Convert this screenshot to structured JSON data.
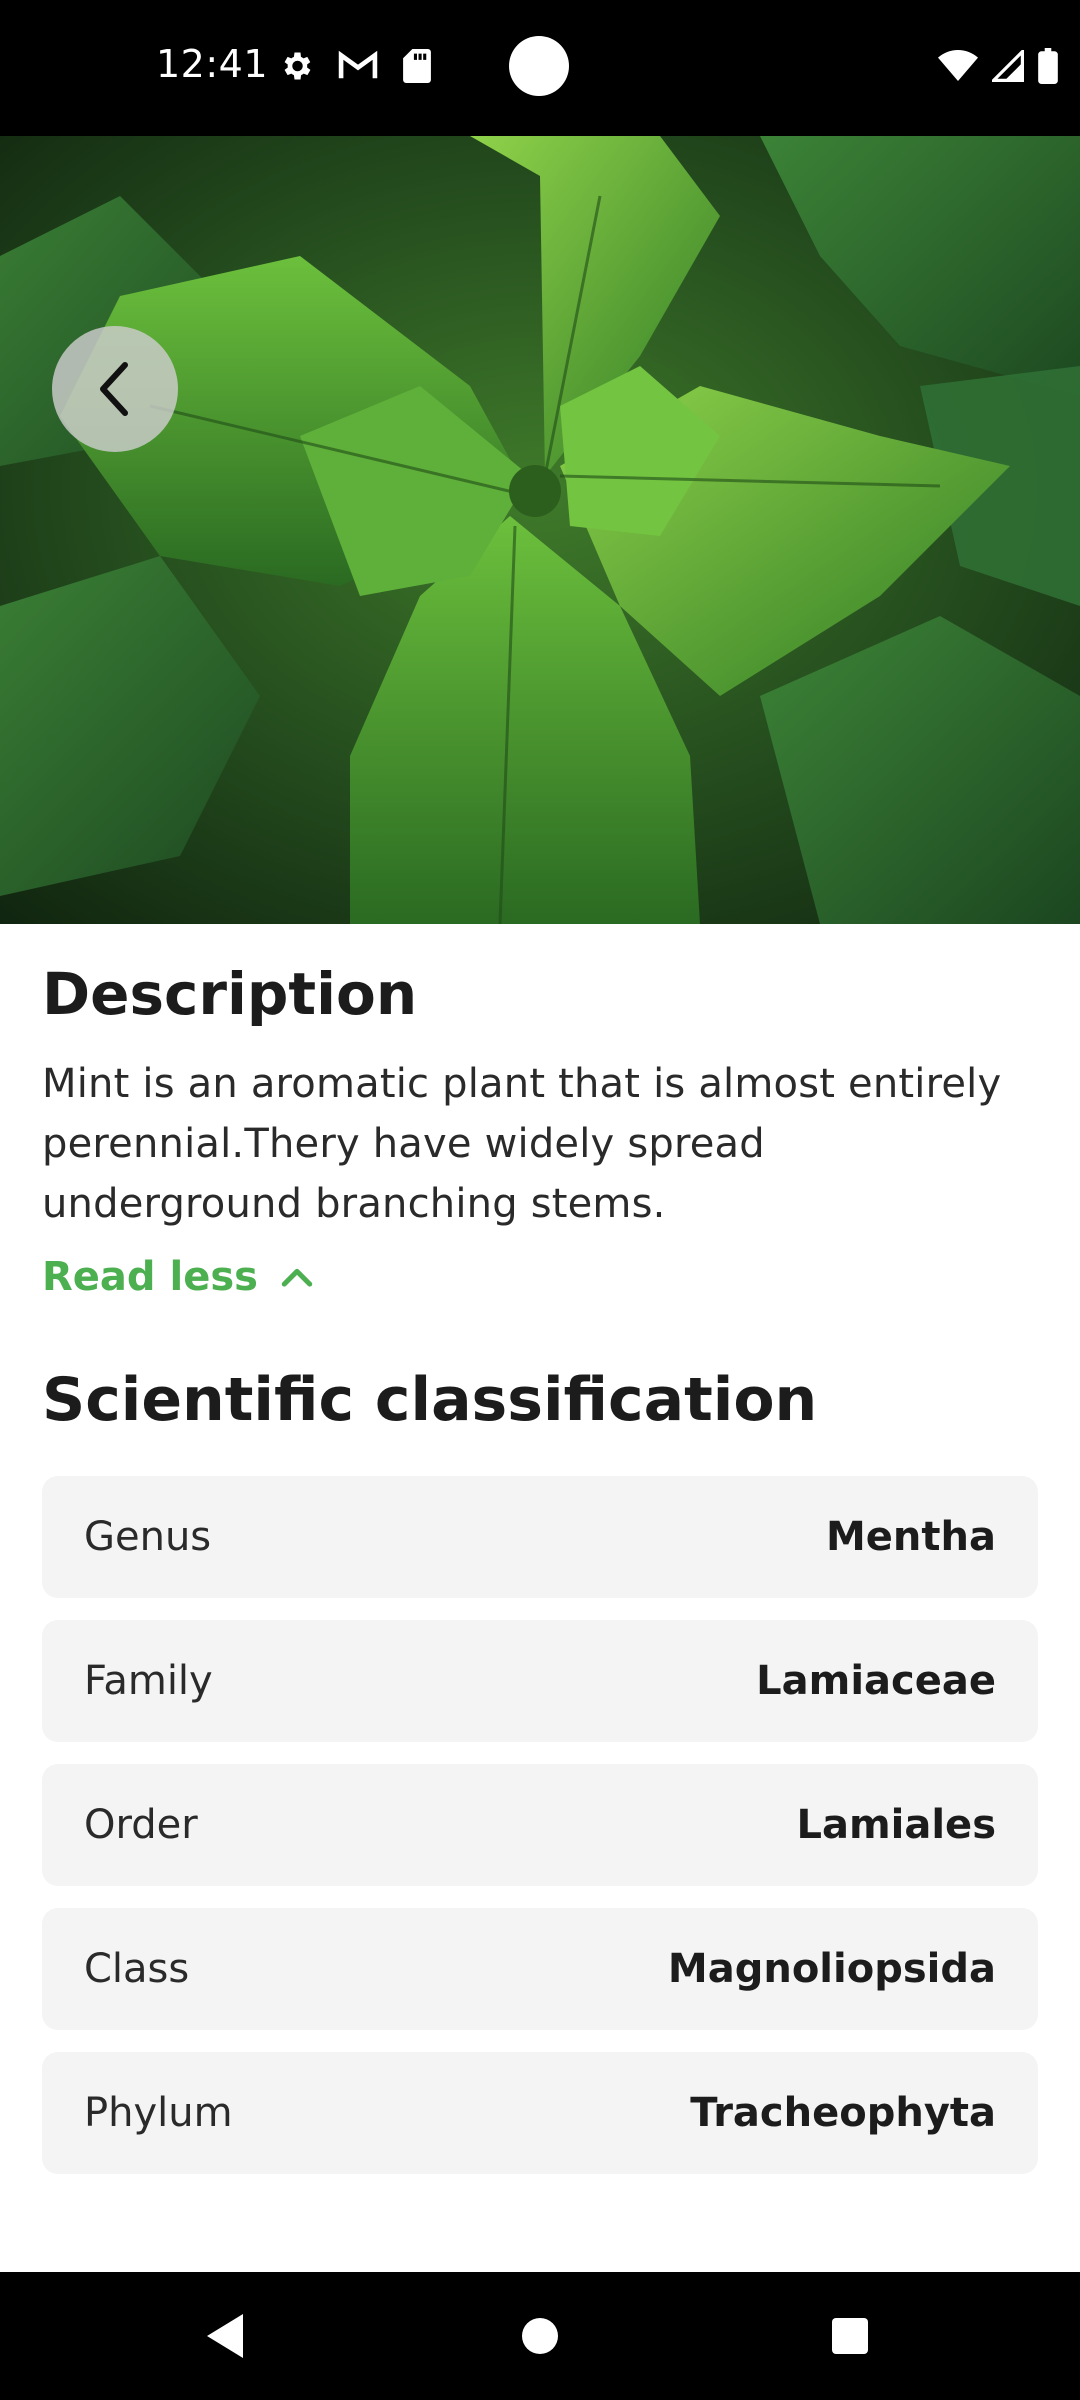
{
  "status_bar": {
    "time": "12:41",
    "icons_left": [
      "settings-icon",
      "gmail-icon",
      "sd-card-icon"
    ],
    "icons_right": [
      "wifi-icon",
      "signal-icon",
      "battery-icon"
    ]
  },
  "hero": {
    "image": "stinging-nettle-plant-photo",
    "back_icon": "chevron-left-icon"
  },
  "description": {
    "title": "Description",
    "text": "Mint is an aromatic plant that is almost entirely perennial.Thery have widely spread underground branching stems.",
    "toggle_label": "Read less",
    "toggle_icon": "chevron-up-icon"
  },
  "classification": {
    "title": "Scientific classification",
    "rows": [
      {
        "label": "Genus",
        "value": "Mentha"
      },
      {
        "label": "Family",
        "value": "Lamiaceae"
      },
      {
        "label": "Order",
        "value": "Lamiales"
      },
      {
        "label": "Class",
        "value": "Magnoliopsida"
      },
      {
        "label": "Phylum",
        "value": "Tracheophyta"
      }
    ]
  },
  "nav_bar": {
    "icons": [
      "back-triangle-icon",
      "home-circle-icon",
      "recents-square-icon"
    ]
  },
  "colors": {
    "accent": "#4caf50",
    "row_background": "#f4f4f4",
    "text_primary": "#1c1c1c",
    "system_bar": "#000000"
  }
}
